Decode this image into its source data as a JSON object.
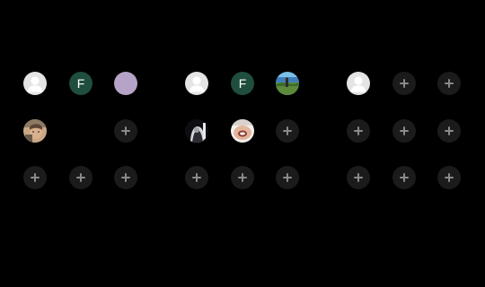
{
  "screen": {
    "background": "#000000"
  },
  "panels": [
    {
      "id": "panel-1",
      "slots": [
        {
          "type": "default"
        },
        {
          "type": "initial",
          "letter": "F",
          "color": "#1f4e3d"
        },
        {
          "type": "color",
          "color": "#b6a4c8"
        },
        {
          "type": "photo",
          "subject": "person-selfie-photo"
        },
        {
          "type": "empty"
        },
        {
          "type": "add"
        },
        {
          "type": "add"
        },
        {
          "type": "add"
        },
        {
          "type": "add"
        }
      ]
    },
    {
      "id": "panel-2",
      "slots": [
        {
          "type": "default"
        },
        {
          "type": "initial",
          "letter": "F",
          "color": "#1f4e3d"
        },
        {
          "type": "photo",
          "subject": "landscape-photo"
        },
        {
          "type": "photo",
          "subject": "dark-portrait-photo"
        },
        {
          "type": "photo",
          "subject": "face-closeup-photo"
        },
        {
          "type": "add"
        },
        {
          "type": "add"
        },
        {
          "type": "add"
        },
        {
          "type": "add"
        }
      ]
    },
    {
      "id": "panel-3",
      "slots": [
        {
          "type": "default"
        },
        {
          "type": "add"
        },
        {
          "type": "add"
        },
        {
          "type": "add"
        },
        {
          "type": "add"
        },
        {
          "type": "add"
        },
        {
          "type": "add"
        },
        {
          "type": "add"
        },
        {
          "type": "add"
        }
      ]
    }
  ]
}
